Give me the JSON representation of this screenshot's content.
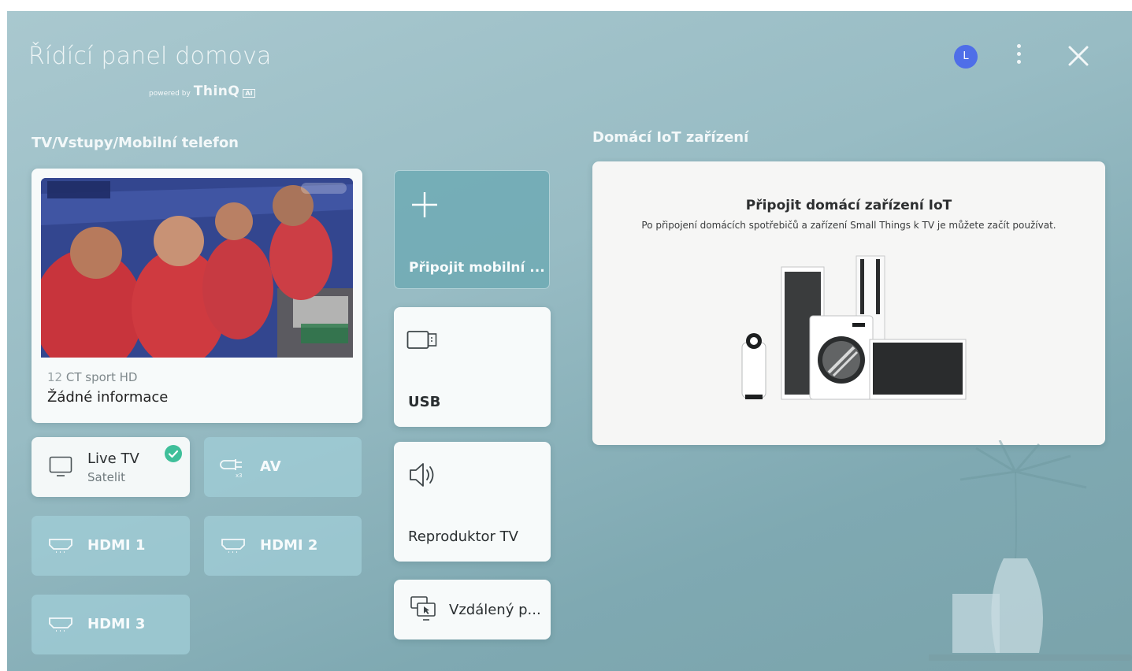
{
  "header": {
    "title": "Řídící panel domova",
    "powered_by": "powered by",
    "brand": "ThinQ",
    "ai_badge": "AI",
    "avatar_letter": "L"
  },
  "sections": {
    "left_title": "TV/Vstupy/Mobilní telefon",
    "right_title": "Domácí IoT zařízení"
  },
  "now_playing": {
    "channel_number": "12",
    "channel_name": "CT sport HD",
    "program_info": "Žádné informace"
  },
  "inputs": {
    "live_tv": {
      "label": "Live TV",
      "sublabel": "Satelit"
    },
    "av": {
      "label": "AV"
    },
    "hdmi1": {
      "label": "HDMI 1"
    },
    "hdmi2": {
      "label": "HDMI 2"
    },
    "hdmi3": {
      "label": "HDMI 3"
    }
  },
  "devices": {
    "connect_mobile": "Připojit mobilní ...",
    "usb": "USB",
    "speaker": "Reproduktor TV",
    "remote": "Vzdálený p..."
  },
  "iot": {
    "heading": "Připojit domácí zařízení IoT",
    "subtext": "Po připojení domácích spotřebičů a zařízení Small Things k TV je můžete začít používat."
  },
  "colors": {
    "background": "#98bcc4",
    "tile": "#a0cdd7",
    "accent_check": "#3fbf9a",
    "avatar": "#4f6ee8"
  }
}
